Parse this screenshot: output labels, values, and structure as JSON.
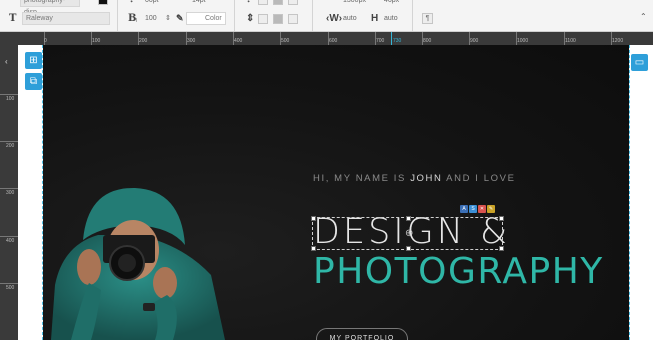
{
  "toolbar": {
    "row1": {
      "preset_value": "photography-disp",
      "letter_spacing_value": "00pt",
      "line_height_value": "14pt",
      "width_value": "1300px",
      "height_value": "46px"
    },
    "row2": {
      "font_family": "Raleway",
      "font_size": "100",
      "color_label": "Color",
      "width_label": "W",
      "width_value": "auto",
      "height_label": "H",
      "height_value": "auto"
    },
    "icons": [
      "text-icon",
      "bold-size-icon",
      "eyedropper-icon",
      "vertical-align-icon",
      "align-top-icon",
      "align-middle-icon",
      "align-bottom-icon",
      "width-icon",
      "height-icon",
      "paragraph-icon"
    ]
  },
  "ruler": {
    "top_labels": [
      "0",
      "100",
      "200",
      "300",
      "400",
      "500",
      "600",
      "700",
      "730",
      "800",
      "900",
      "1000",
      "1100",
      "1200"
    ],
    "left_labels": [
      "100",
      "200",
      "300",
      "400",
      "500"
    ],
    "marker_label": "730"
  },
  "hero": {
    "intro_prefix": "HI, MY NAME IS ",
    "intro_name": "JOHN",
    "intro_suffix": " AND I LOVE",
    "title_line1": "DESIGN &",
    "title_line2": "PHOTOGRAPHY",
    "button_label": "MY PORTFOLIO",
    "accent_color": "#2fb7a7"
  },
  "side_tools": {
    "left": [
      "add-layer-icon",
      "duplicate-icon"
    ],
    "right": [
      "desktop-preview-icon"
    ]
  },
  "mini_tools": [
    {
      "icon": "font-icon",
      "glyph": "A",
      "color": "#3b6fb6"
    },
    {
      "icon": "style-icon",
      "glyph": "S",
      "color": "#3b8fd6"
    },
    {
      "icon": "delete-icon",
      "glyph": "✕",
      "color": "#d9534f"
    },
    {
      "icon": "settings-icon",
      "glyph": "✎",
      "color": "#c9a227"
    }
  ]
}
